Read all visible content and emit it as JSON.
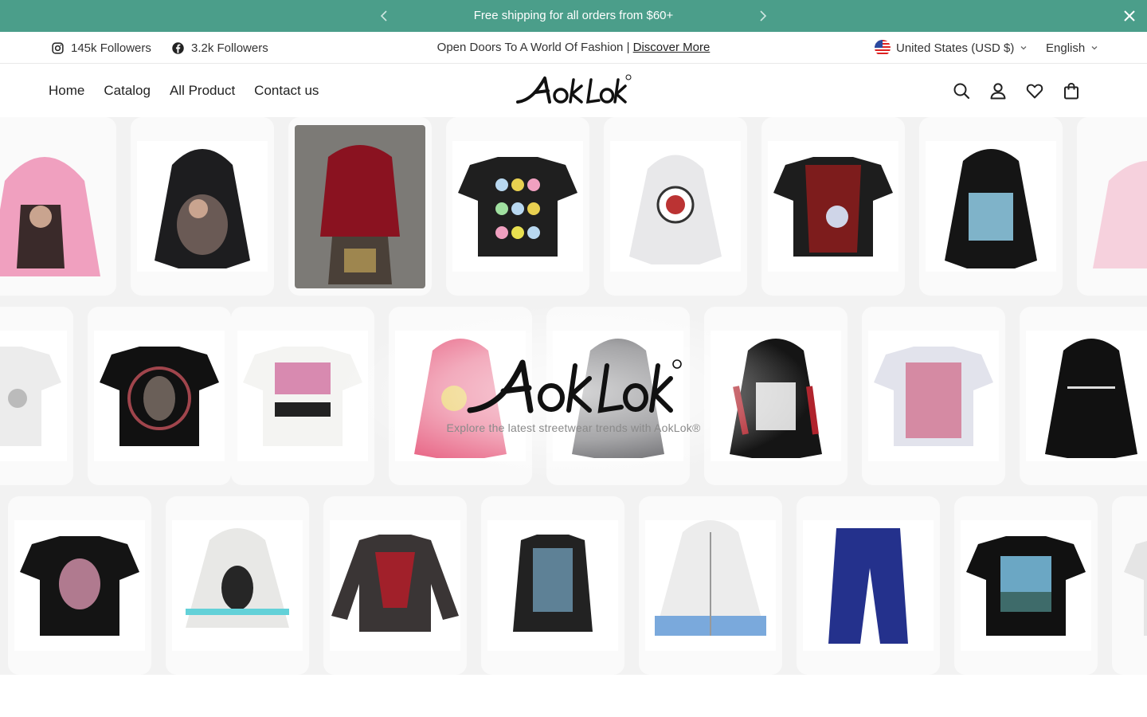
{
  "announcement": {
    "text": "Free shipping for all orders from $60+",
    "prev_icon": "chevron-left-icon",
    "next_icon": "chevron-right-icon",
    "close_icon": "close-icon",
    "bg_color": "#4b9e8a"
  },
  "utility": {
    "instagram": {
      "icon": "instagram-icon",
      "label": "145k Followers"
    },
    "facebook": {
      "icon": "facebook-icon",
      "label": "3.2k Followers"
    },
    "promo_text": "Open Doors To A World Of Fashion | ",
    "promo_link": "Discover More",
    "country": {
      "icon": "us-flag-icon",
      "label": "United States (USD $)"
    },
    "language": {
      "label": "English"
    }
  },
  "header": {
    "nav": [
      "Home",
      "Catalog",
      "All Product",
      "Contact us"
    ],
    "logo_text": "AokLok",
    "icons": [
      "search-icon",
      "account-icon",
      "wishlist-heart-icon",
      "cart-bag-icon"
    ]
  },
  "hero": {
    "logo_text": "AokLok",
    "tagline": "Explore the latest streetwear trends with AokLok®",
    "rows": [
      [
        "pink hoodie",
        "black hoodie",
        "red hoodie photo",
        "black tee skulls",
        "white hoodie",
        "black tee red print",
        "black hoodie blue print",
        "pink hoodie"
      ],
      [
        "white tee",
        "black tee portrait",
        "white tee pink graphic",
        "pink hoodie smiley",
        "grey hoodie",
        "black hoodie red print",
        "white tee eyes",
        "black hoodie text"
      ],
      [
        "black tee portrait",
        "white hoodie face",
        "red long sleeve",
        "black sweatshirt glitch",
        "white zip hoodie",
        "blue jeans",
        "black tee landscape",
        "white tee"
      ]
    ]
  }
}
